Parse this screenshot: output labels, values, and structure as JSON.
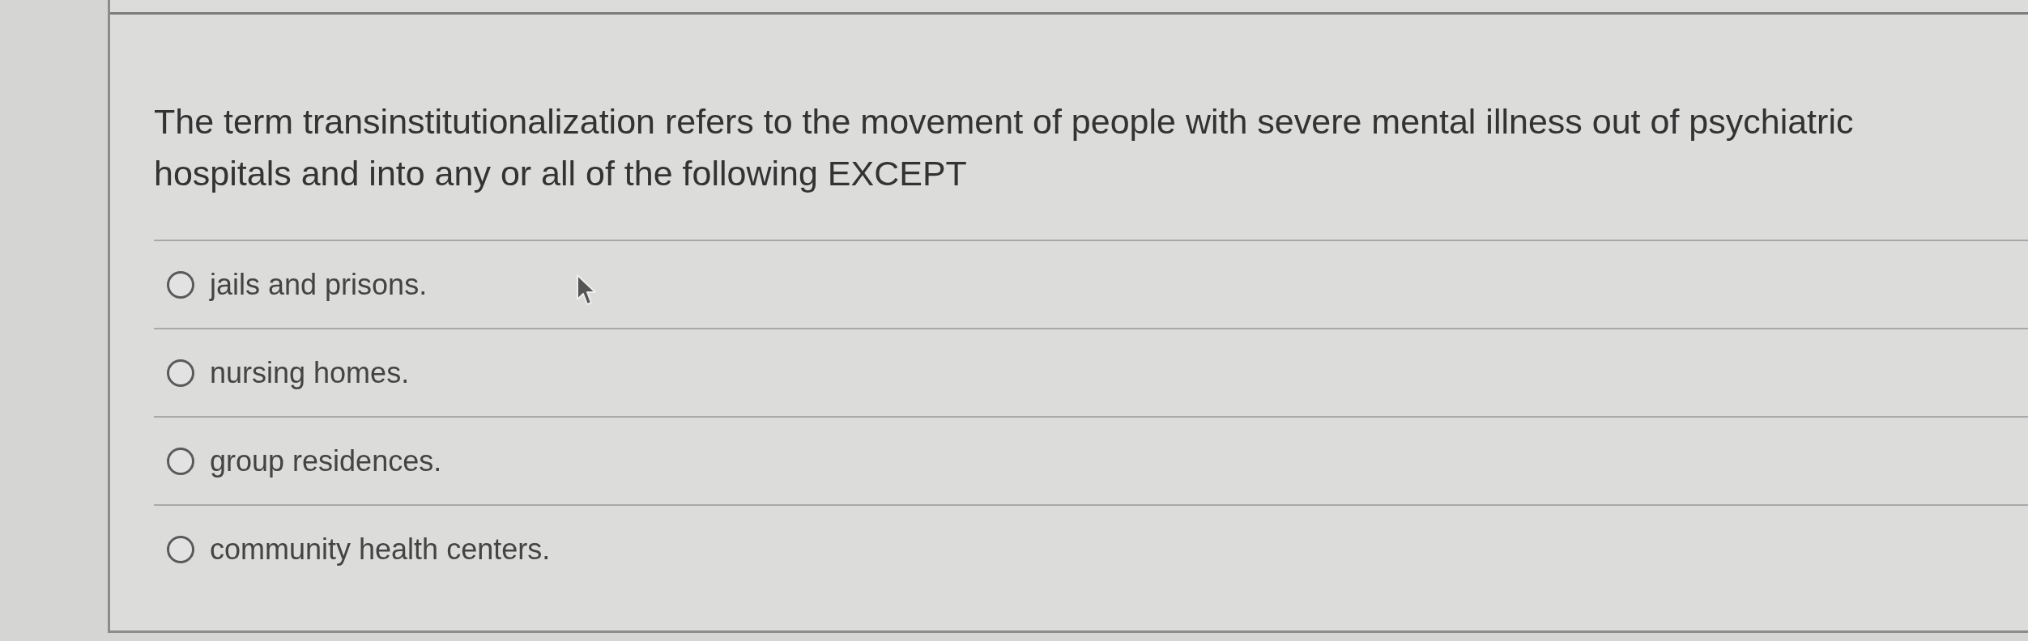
{
  "question": {
    "text": "The term transinstitutionalization refers to the movement of people with severe mental illness out of psychiatric hospitals and into any or all of the following EXCEPT"
  },
  "options": [
    {
      "label": "jails and prisons.",
      "selected": false
    },
    {
      "label": "nursing homes.",
      "selected": false
    },
    {
      "label": "group residences.",
      "selected": false
    },
    {
      "label": "community health centers.",
      "selected": false
    }
  ]
}
